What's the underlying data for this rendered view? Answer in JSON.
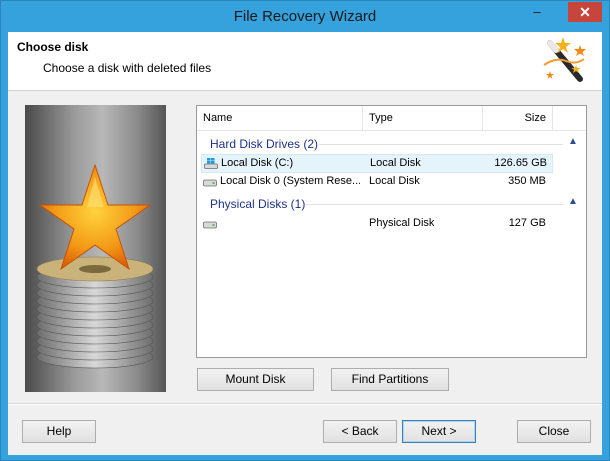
{
  "window": {
    "title": "File Recovery Wizard",
    "minimize_glyph": "–",
    "close_glyph": "✕"
  },
  "header": {
    "title": "Choose disk",
    "subtitle": "Choose a disk with deleted files",
    "icon": "magic-wand-icon"
  },
  "disk_list": {
    "columns": [
      "Name",
      "Type",
      "Size"
    ],
    "groups": [
      {
        "label": "Hard Disk Drives (2)",
        "rows": [
          {
            "name": "Local Disk (C:)",
            "type": "Local Disk",
            "size": "126.65 GB",
            "icon": "windows-drive-icon",
            "selected": true
          },
          {
            "name": "Local Disk 0 (System Rese...",
            "type": "Local Disk",
            "size": "350 MB",
            "icon": "drive-icon",
            "selected": false
          }
        ]
      },
      {
        "label": "Physical Disks (1)",
        "rows": [
          {
            "name": "",
            "type": "Physical Disk",
            "size": "127 GB",
            "icon": "drive-icon",
            "selected": false
          }
        ]
      }
    ],
    "collapse_glyph": "▲"
  },
  "buttons": {
    "mount_disk": "Mount Disk",
    "find_partitions": "Find Partitions",
    "help": "Help",
    "back": "< Back",
    "next": "Next >",
    "close": "Close"
  },
  "colors": {
    "titlebar": "#35a2dd",
    "group_header": "#1e3287",
    "selection": "#e5f3fb",
    "close_button": "#c7463b"
  }
}
